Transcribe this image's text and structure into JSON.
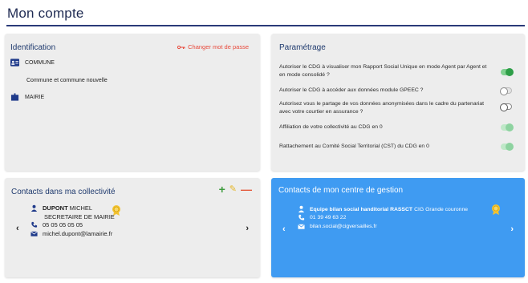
{
  "page": {
    "title": "Mon compte"
  },
  "identification": {
    "title": "Identification",
    "change_password": "Changer mot de passe",
    "commune_label": "COMMUNE",
    "commune_type": "Commune et commune nouvelle",
    "mairie_label": "MAIRIE"
  },
  "parametrage": {
    "title": "Paramétrage",
    "items": [
      {
        "label": "Autoriser le CDG à visualiser mon Rapport Social Unique en mode Agent par Agent et en mode consolidé ?",
        "state": "on"
      },
      {
        "label": "Autoriser le CDG à accéder aux données module GPEEC ?",
        "state": "off"
      },
      {
        "label": "Autorisez vous le partage de vos données anonymisées dans le cadre du partenariat avec votre courtier en assurance ?",
        "state": "indeterminate"
      },
      {
        "label": "Affiliation de votre collectivité au CDG en 0",
        "state": "on-disabled"
      },
      {
        "label": "Rattachement au Comité Social Territorial (CST) du CDG en 0",
        "state": "on-disabled"
      }
    ]
  },
  "contacts_collectivite": {
    "title": "Contacts dans ma collectivité",
    "add_icon": "plus-icon",
    "edit_icon": "pencil-icon",
    "delete_icon": "minus-icon",
    "contact": {
      "last_name": "DUPONT",
      "first_name": "MICHEL",
      "role": "SECRETAIRE DE MAIRIE",
      "phone": "05 05 05 05 05",
      "email": "michel.dupont@lamairie.fr"
    }
  },
  "centre_gestion": {
    "title": "Contacts de mon centre de gestion",
    "contact": {
      "name": "Equipe bilan social handitorial RASSCT",
      "org": "CIG Grande couronne",
      "phone": "01 39 49 63 22",
      "email": "bilan.social@cigversailles.fr"
    }
  },
  "colors": {
    "accent_red": "#e8483a",
    "toggle_on": "#2e9e48",
    "cdg_card_bg": "#3f9bf2",
    "title_navy": "#1e2a52"
  }
}
